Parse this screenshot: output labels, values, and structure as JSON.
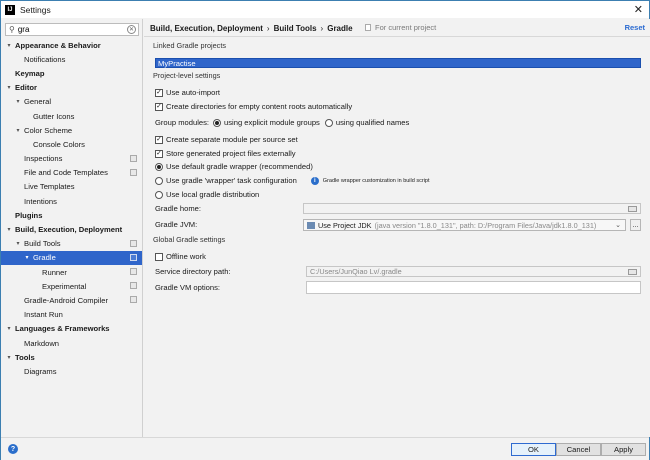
{
  "window": {
    "title": "Settings",
    "app_icon": "IJ"
  },
  "search": {
    "value": "gra"
  },
  "tree": [
    {
      "label": "Appearance & Behavior",
      "level": 0,
      "bold": true,
      "arrow": "▾"
    },
    {
      "label": "Notifications",
      "level": 1
    },
    {
      "label": "Keymap",
      "level": 0,
      "bold": true
    },
    {
      "label": "Editor",
      "level": 0,
      "bold": true,
      "arrow": "▾"
    },
    {
      "label": "General",
      "level": 1,
      "arrow": "▾"
    },
    {
      "label": "Gutter Icons",
      "level": 2
    },
    {
      "label": "Color Scheme",
      "level": 1,
      "arrow": "▾"
    },
    {
      "label": "Console Colors",
      "level": 2
    },
    {
      "label": "Inspections",
      "level": 1,
      "cfg": true
    },
    {
      "label": "File and Code Templates",
      "level": 1,
      "cfg": true
    },
    {
      "label": "Live Templates",
      "level": 1
    },
    {
      "label": "Intentions",
      "level": 1
    },
    {
      "label": "Plugins",
      "level": 0,
      "bold": true
    },
    {
      "label": "Build, Execution, Deployment",
      "level": 0,
      "bold": true,
      "arrow": "▾"
    },
    {
      "label": "Build Tools",
      "level": 1,
      "arrow": "▾",
      "cfg": true
    },
    {
      "label": "Gradle",
      "level": 2,
      "arrow": "▾",
      "cfg": true,
      "selected": true
    },
    {
      "label": "Runner",
      "level": 3,
      "cfg": true
    },
    {
      "label": "Experimental",
      "level": 3,
      "cfg": true
    },
    {
      "label": "Gradle-Android Compiler",
      "level": 1,
      "cfg": true
    },
    {
      "label": "Instant Run",
      "level": 1
    },
    {
      "label": "Languages & Frameworks",
      "level": 0,
      "bold": true,
      "arrow": "▾"
    },
    {
      "label": "Markdown",
      "level": 1
    },
    {
      "label": "Tools",
      "level": 0,
      "bold": true,
      "arrow": "▾"
    },
    {
      "label": "Diagrams",
      "level": 1
    }
  ],
  "breadcrumb": {
    "items": [
      "Build, Execution, Deployment",
      "Build Tools",
      "Gradle"
    ],
    "sep": "›"
  },
  "for_current_project": "For current project",
  "reset": "Reset",
  "linked_projects": {
    "header": "Linked Gradle projects",
    "items": [
      "MyPractise"
    ]
  },
  "project_settings": {
    "header": "Project-level settings",
    "use_auto_import": {
      "label": "Use auto-import",
      "checked": true
    },
    "create_dirs": {
      "label": "Create directories for empty content roots automatically",
      "checked": true
    },
    "group_modules": {
      "label": "Group modules:",
      "opt1": "using explicit module groups",
      "opt2": "using qualified names",
      "selected": "opt1"
    },
    "separate_module": {
      "label": "Create separate module per source set",
      "checked": true
    },
    "store_externally": {
      "label": "Store generated project files externally",
      "checked": true
    },
    "wrapper_default": {
      "label": "Use default gradle wrapper (recommended)",
      "selected": true
    },
    "wrapper_task": {
      "label": "Use gradle 'wrapper' task configuration",
      "selected": false
    },
    "wrapper_hint": "Gradle wrapper customization in build script",
    "local_dist": {
      "label": "Use local gradle distribution",
      "selected": false
    },
    "gradle_home": {
      "label": "Gradle home:",
      "value": ""
    },
    "gradle_jvm": {
      "label": "Gradle JVM:",
      "value": "Use Project JDK",
      "detail": "(java version \"1.8.0_131\", path: D:/Program Files/Java/jdk1.8.0_131)",
      "more": "..."
    }
  },
  "global_settings": {
    "header": "Global Gradle settings",
    "offline": {
      "label": "Offline work",
      "checked": false
    },
    "service_dir": {
      "label": "Service directory path:",
      "value": "C:/Users/JunQiao Lv/.gradle"
    },
    "vm_options": {
      "label": "Gradle VM options:",
      "value": ""
    }
  },
  "buttons": {
    "help": "?",
    "ok": "OK",
    "cancel": "Cancel",
    "apply": "Apply"
  },
  "colors": {
    "selection": "#2f65ca",
    "link": "#2b6bd1",
    "info": "#2a6ecb"
  },
  "icons": [
    "app-icon",
    "search-icon",
    "clear-icon",
    "close-icon",
    "project-config-icon",
    "folder-icon",
    "info-icon",
    "help-icon",
    "jdk-icon"
  ]
}
